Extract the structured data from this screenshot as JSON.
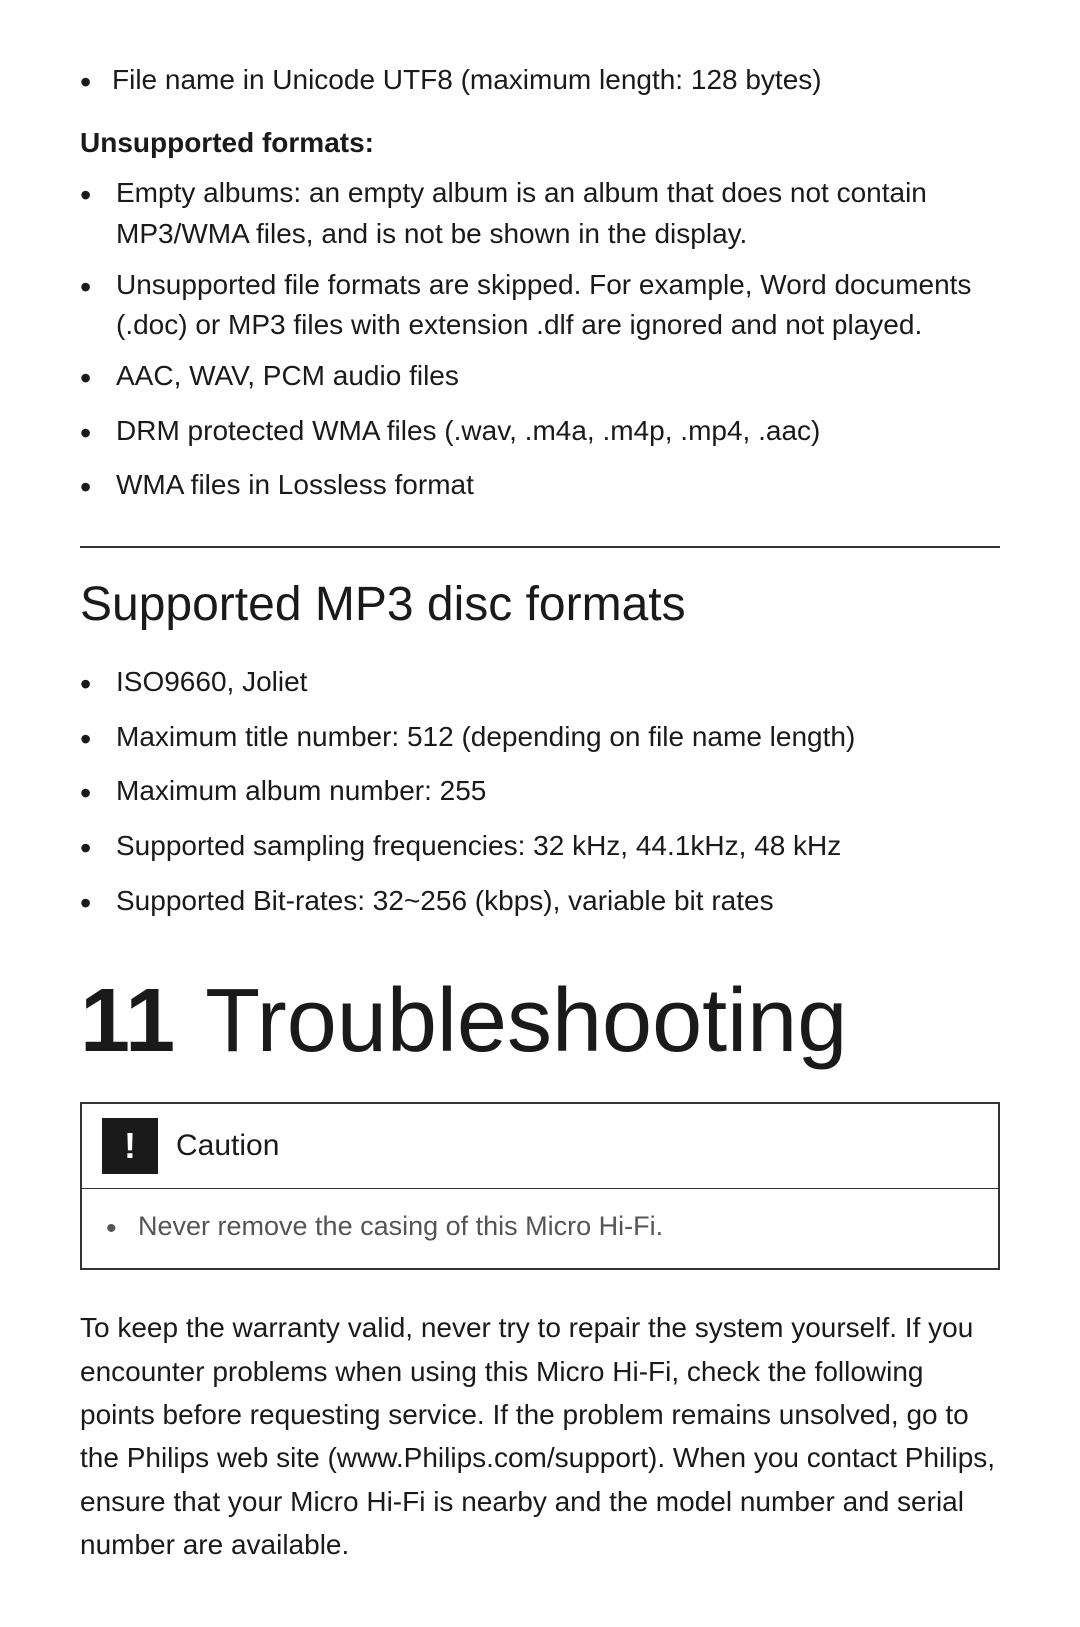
{
  "top_section": {
    "first_bullet": "File name in Unicode UTF8 (maximum length: 128 bytes)",
    "unsupported_heading": "Unsupported formats:",
    "unsupported_bullets": [
      "Empty albums: an empty album is an album that does not contain MP3/WMA files, and is not be shown in the display.",
      "Unsupported file formats are skipped. For example, Word documents (.doc) or MP3 files with extension .dlf are ignored and not played.",
      "AAC, WAV, PCM audio files",
      "DRM protected WMA files (.wav, .m4a, .m4p, .mp4, .aac)",
      "WMA files in Lossless format"
    ]
  },
  "mp3_section": {
    "heading": "Supported MP3 disc formats",
    "bullets": [
      "ISO9660, Joliet",
      "Maximum title number: 512 (depending on file name length)",
      "Maximum album number: 255",
      "Supported sampling frequencies: 32 kHz, 44.1kHz, 48 kHz",
      "Supported Bit-rates: 32~256 (kbps), variable bit rates"
    ]
  },
  "chapter": {
    "number": "11",
    "title": "Troubleshooting"
  },
  "caution": {
    "label": "Caution",
    "icon_symbol": "!",
    "bullets": [
      "Never remove the casing of this Micro Hi-Fi."
    ]
  },
  "paragraph": {
    "text": "To keep the warranty valid, never try to repair the system yourself. If you encounter problems when using this Micro Hi-Fi, check the following points before requesting service. If the problem remains unsolved, go to the Philips web site (www.Philips.com/support). When you contact Philips, ensure that your Micro Hi-Fi is nearby and the model number and serial number are available."
  },
  "bullet_char": "•"
}
